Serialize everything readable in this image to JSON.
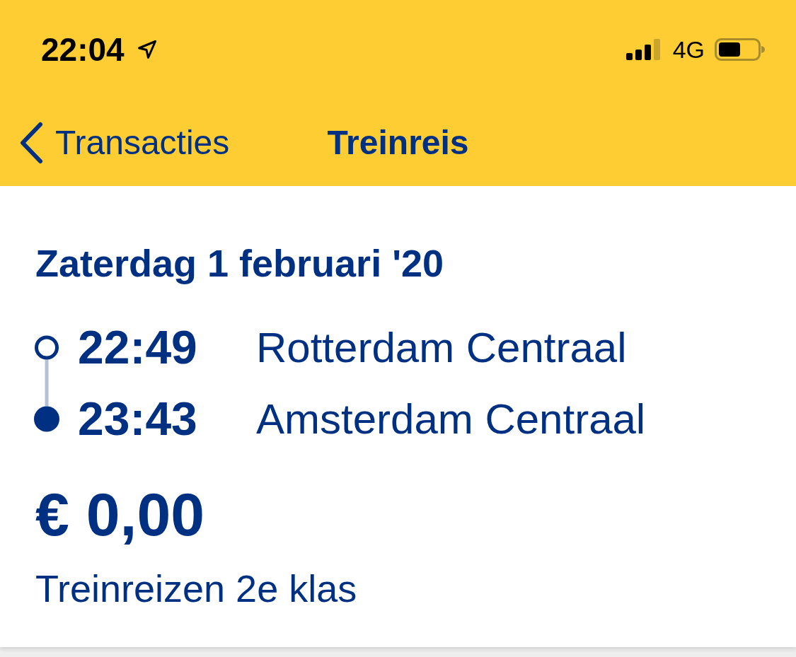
{
  "status_bar": {
    "time": "22:04",
    "network": "4G"
  },
  "nav_bar": {
    "back_label": "Transacties",
    "title": "Treinreis"
  },
  "trip": {
    "date": "Zaterdag 1 februari '20",
    "stops": [
      {
        "kind": "departure",
        "time": "22:49",
        "station": "Rotterdam Centraal"
      },
      {
        "kind": "arrival",
        "time": "23:43",
        "station": "Amsterdam Centraal"
      }
    ],
    "price": "€ 0,00",
    "product": "Treinreizen 2e klas"
  }
}
